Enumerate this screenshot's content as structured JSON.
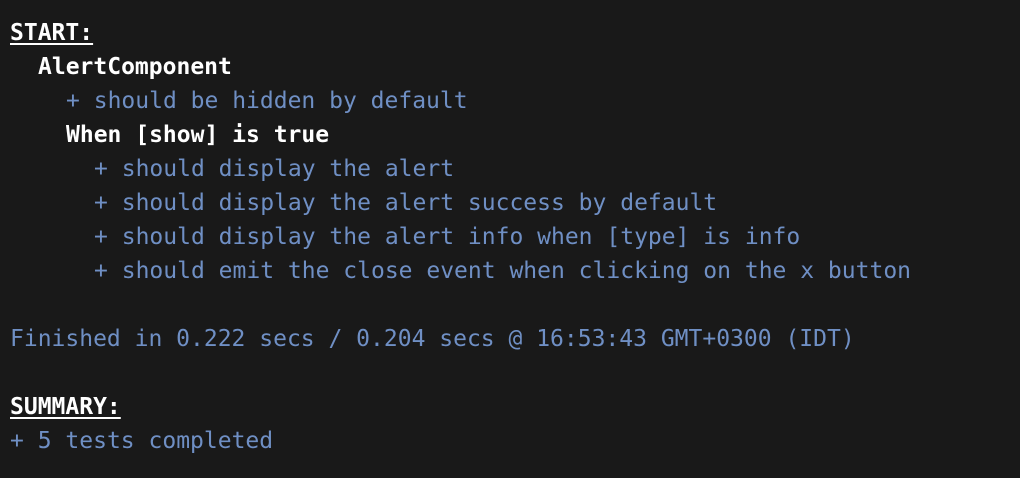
{
  "terminal": {
    "start_heading": "START:",
    "suite_name": "AlertComponent",
    "suite_specs": [
      {
        "prefix": "+",
        "text": "should be hidden by default"
      }
    ],
    "nested_suite_name": "When [show] is true",
    "nested_specs": [
      {
        "prefix": "+",
        "text": "should display the alert"
      },
      {
        "prefix": "+",
        "text": "should display the alert success by default"
      },
      {
        "prefix": "+",
        "text": "should display the alert info when [type] is info"
      },
      {
        "prefix": "+",
        "text": "should emit the close event when clicking on the x button"
      }
    ],
    "finished_line": "Finished in 0.222 secs / 0.204 secs @ 16:53:43 GMT+0300 (IDT)",
    "summary_heading": "SUMMARY:",
    "summary_prefix": "+",
    "summary_text": "5 tests completed"
  },
  "colors": {
    "background": "#191919",
    "heading": "#ffffff",
    "spec_text": "#6f8fc4"
  }
}
